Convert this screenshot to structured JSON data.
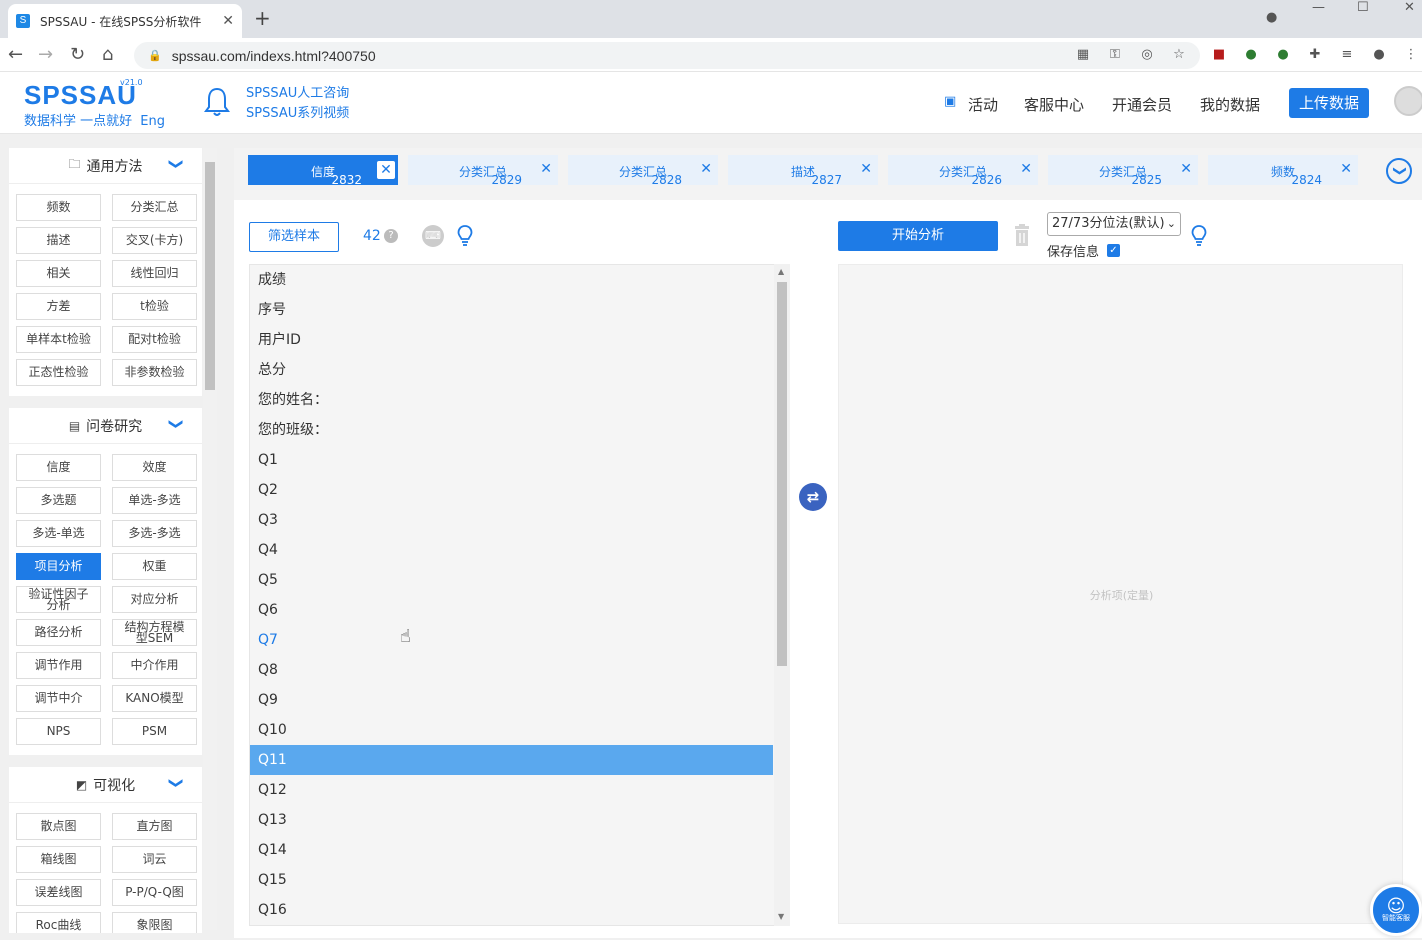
{
  "browser": {
    "tab_title": "SPSSAU - 在线SPSS分析软件",
    "favicon_letter": "S",
    "url": "spssau.com/indexs.html?400750"
  },
  "header": {
    "logo_text": "SPSSAU",
    "version": "v21.0",
    "slogan": "数据科学 一点就好",
    "lang": "Eng",
    "consult_link": "SPSSAU人工咨询",
    "video_link": "SPSSAU系列视频",
    "nav": [
      "活动",
      "客服中心",
      "开通会员",
      "我的数据"
    ],
    "upload_label": "上传数据"
  },
  "sidebar": {
    "sections": [
      {
        "title": "通用方法",
        "items": [
          "频数",
          "分类汇总",
          "描述",
          "交叉(卡方)",
          "相关",
          "线性回归",
          "方差",
          "t检验",
          "单样本t检验",
          "配对t检验",
          "正态性检验",
          "非参数检验"
        ]
      },
      {
        "title": "问卷研究",
        "items": [
          "信度",
          "效度",
          "多选题",
          "单选-多选",
          "多选-单选",
          "多选-多选",
          "项目分析",
          "权重",
          "验证性因子分析",
          "对应分析",
          "路径分析",
          "结构方程模型SEM",
          "调节作用",
          "中介作用",
          "调节中介",
          "KANO模型",
          "NPS",
          "PSM"
        ]
      },
      {
        "title": "可视化",
        "items": [
          "散点图",
          "直方图",
          "箱线图",
          "词云",
          "误差线图",
          "P-P/Q-Q图",
          "Roc曲线",
          "象限图"
        ]
      }
    ],
    "active_item": "项目分析"
  },
  "analysis_tabs": [
    {
      "label": "信度",
      "num": "2832"
    },
    {
      "label": "分类汇总",
      "num": "2829"
    },
    {
      "label": "分类汇总",
      "num": "2828"
    },
    {
      "label": "描述",
      "num": "2827"
    },
    {
      "label": "分类汇总",
      "num": "2826"
    },
    {
      "label": "分类汇总",
      "num": "2825"
    },
    {
      "label": "频数",
      "num": "2824"
    }
  ],
  "toolbar": {
    "filter_label": "筛选样本",
    "sample_count": "42",
    "start_label": "开始分析",
    "method_value": "27/73分位法(默认)",
    "save_info_label": "保存信息"
  },
  "variables": [
    "成绩",
    "序号",
    "用户ID",
    "总分",
    "您的姓名：",
    "您的班级：",
    "Q1",
    "Q2",
    "Q3",
    "Q4",
    "Q5",
    "Q6",
    "Q7",
    "Q8",
    "Q9",
    "Q10",
    "Q11",
    "Q12",
    "Q13",
    "Q14",
    "Q15",
    "Q16"
  ],
  "selected_variable": "Q11",
  "hovered_variable": "Q7",
  "analysis_placeholder": "分析项(定量)",
  "service_label": "智能客服",
  "colors": {
    "accent": "#1e7be6",
    "selected_row": "#5aa8ee"
  }
}
